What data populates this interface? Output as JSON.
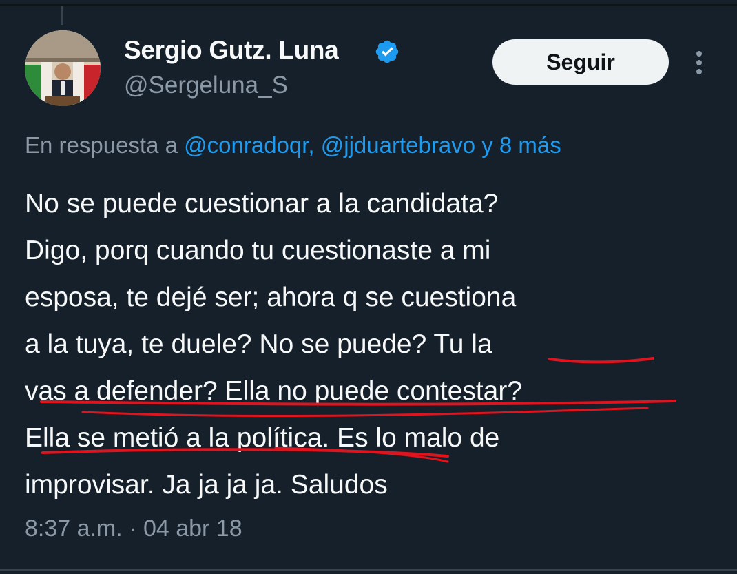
{
  "author": {
    "display_name": "Sergio Gutz. Luna",
    "handle": "@Sergeluna_S",
    "verified": true
  },
  "follow_button": {
    "label": "Seguir"
  },
  "reply_context": {
    "prefix": "En respuesta a ",
    "mentions": "@conradoqr, @jjduartebravo y 8 más"
  },
  "tweet": {
    "text": "No se puede cuestionar a la candidata?\nDigo, porq cuando tu cuestionaste a mi\nesposa, te dejé ser; ahora q se cuestiona\na la tuya, te duele? No se puede? Tu la\nvas a defender? Ella no puede contestar?\nElla se metió a la política. Es lo malo de\nimprovisar. Ja ja ja ja. Saludos",
    "timestamp": "8:37 a.m. · 04 abr 18"
  },
  "colors": {
    "background": "#15202b",
    "text": "#f7f9f9",
    "secondary_text": "#8b98a5",
    "accent": "#1d9bf0",
    "annotation_red": "#e0141e"
  },
  "icons": {
    "verified": "verified-badge-icon",
    "more": "more-vertical-icon"
  }
}
